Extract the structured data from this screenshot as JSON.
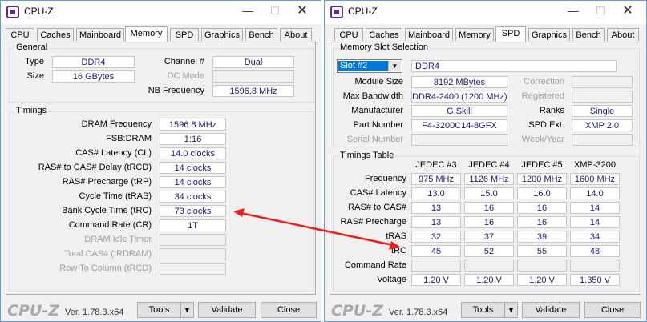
{
  "left": {
    "title": "CPU-Z",
    "tabs": [
      "CPU",
      "Caches",
      "Mainboard",
      "Memory",
      "SPD",
      "Graphics",
      "Bench",
      "About"
    ],
    "active_tab": "Memory",
    "general": {
      "title": "General",
      "type_label": "Type",
      "type_value": "DDR4",
      "size_label": "Size",
      "size_value": "16 GBytes",
      "channel_label": "Channel #",
      "channel_value": "Dual",
      "dcmode_label": "DC Mode",
      "dcmode_value": "",
      "nbfreq_label": "NB Frequency",
      "nbfreq_value": "1596.8 MHz"
    },
    "timings": {
      "title": "Timings",
      "rows": [
        {
          "label": "DRAM Frequency",
          "value": "1596.8 MHz",
          "disabled": false
        },
        {
          "label": "FSB:DRAM",
          "value": "1:16",
          "disabled": false
        },
        {
          "label": "CAS# Latency (CL)",
          "value": "14.0 clocks",
          "disabled": false
        },
        {
          "label": "RAS# to CAS# Delay (tRCD)",
          "value": "14 clocks",
          "disabled": false
        },
        {
          "label": "RAS# Precharge (tRP)",
          "value": "14 clocks",
          "disabled": false
        },
        {
          "label": "Cycle Time (tRAS)",
          "value": "34 clocks",
          "disabled": false
        },
        {
          "label": "Bank Cycle Time (tRC)",
          "value": "73 clocks",
          "disabled": false
        },
        {
          "label": "Command Rate (CR)",
          "value": "1T",
          "disabled": false
        },
        {
          "label": "DRAM Idle Timer",
          "value": "",
          "disabled": true
        },
        {
          "label": "Total CAS# (tRDRAM)",
          "value": "",
          "disabled": true
        },
        {
          "label": "Row To Column (tRCD)",
          "value": "",
          "disabled": true
        }
      ]
    },
    "footer": {
      "logo": "CPU-Z",
      "version": "Ver. 1.78.3.x64",
      "tools": "Tools",
      "validate": "Validate",
      "close": "Close"
    }
  },
  "right": {
    "title": "CPU-Z",
    "tabs": [
      "CPU",
      "Caches",
      "Mainboard",
      "Memory",
      "SPD",
      "Graphics",
      "Bench",
      "About"
    ],
    "active_tab": "SPD",
    "slot": {
      "title": "Memory Slot Selection",
      "selected": "Slot #2",
      "type": "DDR4",
      "module_size_label": "Module Size",
      "module_size": "8192 MBytes",
      "max_bw_label": "Max Bandwidth",
      "max_bw": "DDR4-2400 (1200 MHz)",
      "manufacturer_label": "Manufacturer",
      "manufacturer": "G.Skill",
      "part_label": "Part Number",
      "part": "F4-3200C14-8GFX",
      "serial_label": "Serial Number",
      "serial": "",
      "correction_label": "Correction",
      "correction": "",
      "registered_label": "Registered",
      "registered": "",
      "ranks_label": "Ranks",
      "ranks": "Single",
      "spd_ext_label": "SPD Ext.",
      "spd_ext": "XMP 2.0",
      "week_year_label": "Week/Year",
      "week_year": ""
    },
    "timings_table": {
      "title": "Timings Table",
      "columns": [
        "JEDEC #3",
        "JEDEC #4",
        "JEDEC #5",
        "XMP-3200"
      ],
      "rows": [
        {
          "label": "Frequency",
          "values": [
            "975 MHz",
            "1126 MHz",
            "1200 MHz",
            "1600 MHz"
          ]
        },
        {
          "label": "CAS# Latency",
          "values": [
            "13.0",
            "15.0",
            "16.0",
            "14.0"
          ]
        },
        {
          "label": "RAS# to CAS#",
          "values": [
            "13",
            "16",
            "16",
            "14"
          ]
        },
        {
          "label": "RAS# Precharge",
          "values": [
            "13",
            "16",
            "16",
            "14"
          ]
        },
        {
          "label": "tRAS",
          "values": [
            "32",
            "37",
            "39",
            "34"
          ]
        },
        {
          "label": "tRC",
          "values": [
            "45",
            "52",
            "55",
            "48"
          ]
        },
        {
          "label": "Command Rate",
          "values": [
            "",
            "",
            "",
            ""
          ]
        },
        {
          "label": "Voltage",
          "values": [
            "1.20 V",
            "1.20 V",
            "1.20 V",
            "1.350 V"
          ]
        }
      ]
    },
    "footer": {
      "logo": "CPU-Z",
      "version": "Ver. 1.78.3.x64",
      "tools": "Tools",
      "validate": "Validate",
      "close": "Close"
    }
  },
  "annotation": {
    "arrow_color": "#e8201a"
  }
}
